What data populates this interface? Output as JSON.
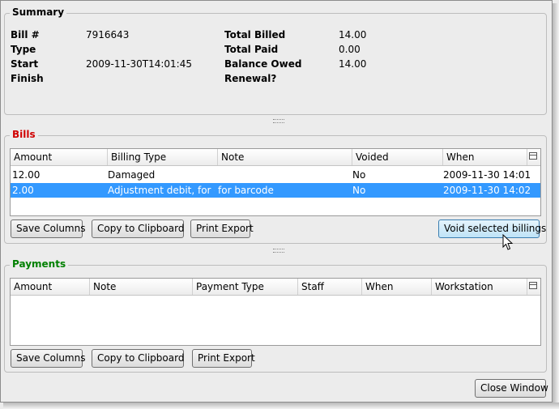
{
  "summary": {
    "legend": "Summary",
    "left": [
      {
        "label": "Bill #",
        "value": "7916643"
      },
      {
        "label": "Type",
        "value": ""
      },
      {
        "label": "Start",
        "value": "2009-11-30T14:01:45"
      },
      {
        "label": "Finish",
        "value": ""
      }
    ],
    "right": [
      {
        "label": "Total Billed",
        "value": "14.00"
      },
      {
        "label": "Total Paid",
        "value": "0.00"
      },
      {
        "label": "Balance Owed",
        "value": "14.00"
      },
      {
        "label": "Renewal?",
        "value": ""
      }
    ]
  },
  "bills": {
    "legend": "Bills",
    "columns": [
      "Amount",
      "Billing Type",
      "Note",
      "Voided",
      "When"
    ],
    "rows": [
      {
        "amount": "12.00",
        "billing_type": "Damaged",
        "note": "",
        "voided": "No",
        "when": "2009-11-30 14:01",
        "selected": false
      },
      {
        "amount": "2.00",
        "billing_type": "Adjustment debit, for c...",
        "note": "for barcode",
        "voided": "No",
        "when": "2009-11-30 14:02",
        "selected": true
      }
    ],
    "buttons": {
      "save_columns": "Save Columns",
      "copy_clipboard": "Copy to Clipboard",
      "print_export": "Print Export",
      "void_selected": "Void selected billings"
    }
  },
  "payments": {
    "legend": "Payments",
    "columns": [
      "Amount",
      "Note",
      "Payment Type",
      "Staff",
      "When",
      "Workstation"
    ],
    "rows": [],
    "buttons": {
      "save_columns": "Save Columns",
      "copy_clipboard": "Copy to Clipboard",
      "print_export": "Print Export"
    }
  },
  "footer": {
    "close_window": "Close Window"
  },
  "colors": {
    "bills_legend": "#d00000",
    "payments_legend": "#008000",
    "selection": "#3399ff",
    "hot_button": "#bfe3f7"
  },
  "icons": {
    "column_picker": "column-picker-icon",
    "cursor": "mouse-pointer-icon"
  }
}
